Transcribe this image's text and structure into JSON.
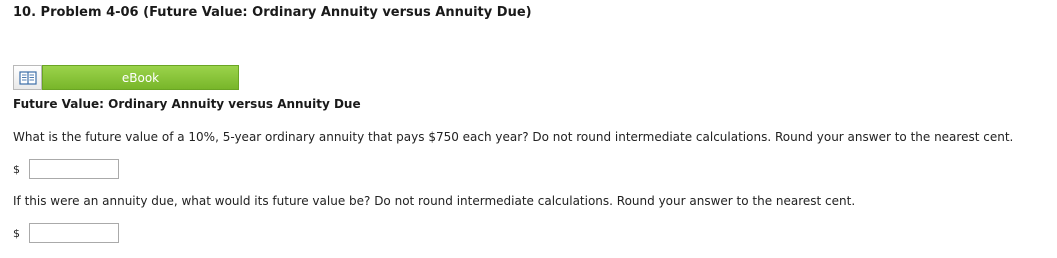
{
  "problem": {
    "title": "10.  Problem 4-06 (Future Value: Ordinary Annuity versus Annuity Due)"
  },
  "ebook": {
    "icon": "book-icon",
    "label": "eBook"
  },
  "section": {
    "heading": "Future Value: Ordinary Annuity versus Annuity Due"
  },
  "questions": [
    {
      "text": "What is the future value of a 10%, 5-year ordinary annuity that pays $750 each year? Do not round intermediate calculations. Round your answer to the nearest cent.",
      "currency": "$",
      "value": ""
    },
    {
      "text": "If this were an annuity due, what would its future value be? Do not round intermediate calculations. Round your answer to the nearest cent.",
      "currency": "$",
      "value": ""
    }
  ],
  "colors": {
    "ebook_button": "#86c43a",
    "ebook_text": "#ffffff"
  }
}
